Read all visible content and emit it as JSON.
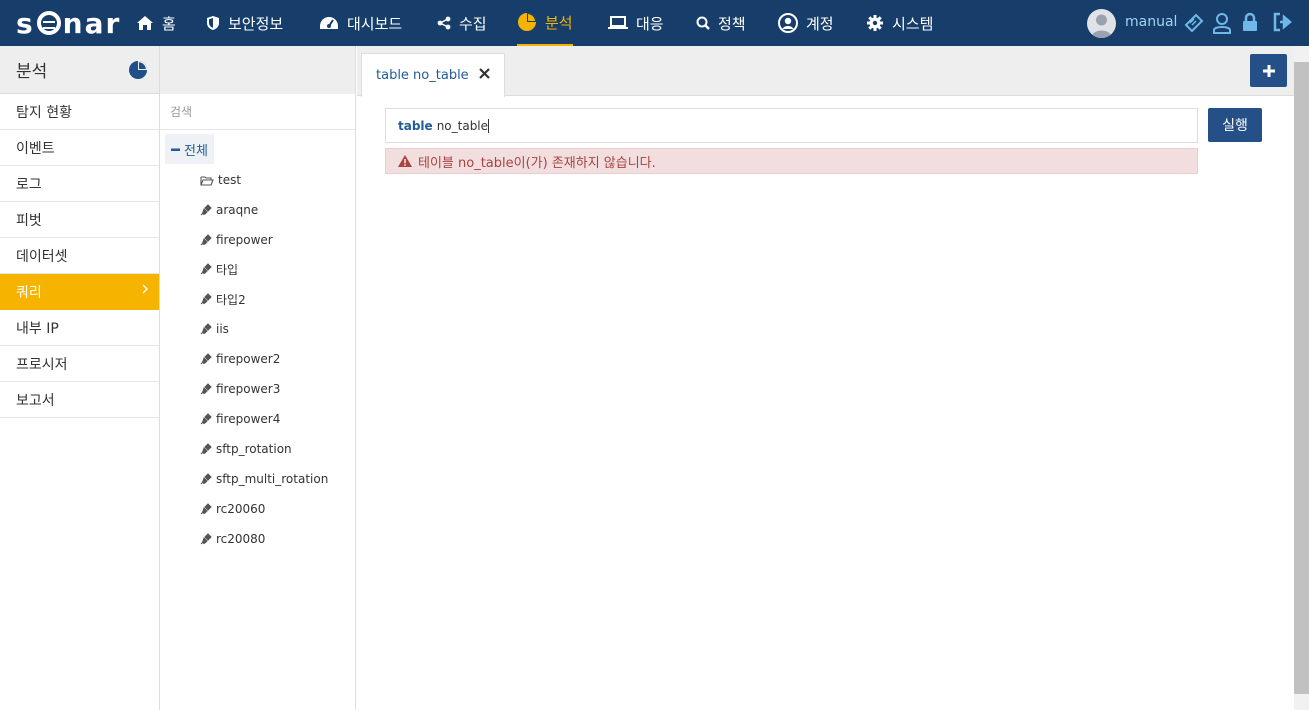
{
  "app": {
    "logo": "sonar"
  },
  "nav": [
    {
      "label": "홈",
      "icon": "home-icon"
    },
    {
      "label": "보안정보",
      "icon": "shield-icon"
    },
    {
      "label": "대시보드",
      "icon": "dashboard-icon"
    },
    {
      "label": "수집",
      "icon": "share-icon"
    },
    {
      "label": "분석",
      "icon": "pie-chart-icon",
      "active": true
    },
    {
      "label": "대응",
      "icon": "laptop-icon"
    },
    {
      "label": "정책",
      "icon": "search-icon"
    },
    {
      "label": "계정",
      "icon": "user-circle-icon"
    },
    {
      "label": "시스템",
      "icon": "gear-icon"
    }
  ],
  "user": {
    "name": "manual"
  },
  "sidebar": {
    "title": "분석",
    "items": [
      {
        "label": "탐지 현황"
      },
      {
        "label": "이벤트"
      },
      {
        "label": "로그"
      },
      {
        "label": "피벗"
      },
      {
        "label": "데이터셋"
      },
      {
        "label": "쿼리",
        "active": true
      },
      {
        "label": "내부 IP"
      },
      {
        "label": "프로시저"
      },
      {
        "label": "보고서"
      }
    ]
  },
  "tree": {
    "search_placeholder": "검색",
    "root_label": "전체",
    "items": [
      {
        "label": "test",
        "icon": "folder-open-icon"
      },
      {
        "label": "araqne",
        "icon": "plug-icon"
      },
      {
        "label": "firepower",
        "icon": "plug-icon"
      },
      {
        "label": "타입",
        "icon": "plug-icon"
      },
      {
        "label": "타입2",
        "icon": "plug-icon"
      },
      {
        "label": "iis",
        "icon": "plug-icon"
      },
      {
        "label": "firepower2",
        "icon": "plug-icon"
      },
      {
        "label": "firepower3",
        "icon": "plug-icon"
      },
      {
        "label": "firepower4",
        "icon": "plug-icon"
      },
      {
        "label": "sftp_rotation",
        "icon": "plug-icon"
      },
      {
        "label": "sftp_multi_rotation",
        "icon": "plug-icon"
      },
      {
        "label": "rc20060",
        "icon": "plug-icon"
      },
      {
        "label": "rc20080",
        "icon": "plug-icon"
      }
    ]
  },
  "tabs": [
    {
      "label": "table no_table"
    }
  ],
  "query": {
    "keyword": "table",
    "value": "no_table",
    "run_label": "실행"
  },
  "error": {
    "message": "테이블 no_table이(가) 존재하지 않습니다."
  },
  "colors": {
    "nav_bg": "#173e6b",
    "accent": "#f6b300",
    "button": "#254f87",
    "error_bg": "#f2dede",
    "error_text": "#a94442"
  }
}
